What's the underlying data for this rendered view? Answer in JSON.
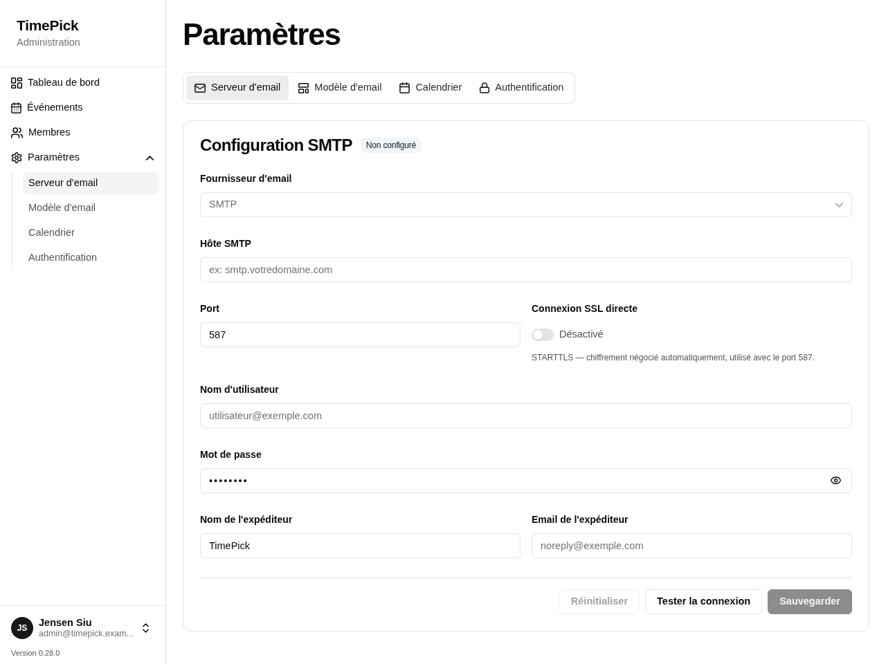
{
  "sidebar": {
    "brand": "TimePick",
    "subtitle": "Administration",
    "items": [
      {
        "label": "Tableau de bord",
        "selected": false
      },
      {
        "label": "Événements",
        "selected": false
      },
      {
        "label": "Membres",
        "selected": false
      },
      {
        "label": "Paramètres",
        "selected": false,
        "expanded": true,
        "children": [
          {
            "label": "Serveur d'email",
            "selected": true
          },
          {
            "label": "Modèle d'email",
            "selected": false
          },
          {
            "label": "Calendrier",
            "selected": false
          },
          {
            "label": "Authentification",
            "selected": false
          }
        ]
      }
    ],
    "user": {
      "initials": "JS",
      "name": "Jensen Siu",
      "email": "admin@timepick.exam..."
    },
    "version": "Version 0.28.0"
  },
  "page": {
    "title": "Paramètres",
    "tabs": [
      {
        "label": "Serveur d'email",
        "selected": true
      },
      {
        "label": "Modèle d'email",
        "selected": false
      },
      {
        "label": "Calendrier",
        "selected": false
      },
      {
        "label": "Authentification",
        "selected": false
      }
    ],
    "form": {
      "title": "Configuration SMTP",
      "status_badge": "Non configuré",
      "rows": [
        {
          "fields": [
            {
              "kind": "select",
              "label": "Fournisseur d'email",
              "value": "SMTP",
              "disabled": true
            }
          ]
        },
        {
          "fields": [
            {
              "kind": "text",
              "label": "Hôte SMTP",
              "placeholder": "ex: smtp.votredomaine.com"
            }
          ]
        },
        {
          "fields": [
            {
              "kind": "text",
              "label": "Port",
              "value": "587"
            },
            {
              "kind": "switch",
              "label": "Connexion SSL directe",
              "on": false,
              "state_text": "Désactivé",
              "help": "STARTTLS — chiffrement négocié automatiquement, utilisé avec le port 587."
            }
          ]
        },
        {
          "fields": [
            {
              "kind": "text",
              "label": "Nom d'utilisateur",
              "placeholder": "utilisateur@exemple.com"
            }
          ]
        },
        {
          "fields": [
            {
              "kind": "password",
              "label": "Mot de passe",
              "value": "••••••••"
            }
          ]
        },
        {
          "fields": [
            {
              "kind": "text",
              "label": "Nom de l'expéditeur",
              "value": "TimePick"
            },
            {
              "kind": "text",
              "label": "Email de l'expéditeur",
              "placeholder": "noreply@exemple.com"
            }
          ]
        }
      ],
      "buttons": [
        {
          "label": "Réinitialiser",
          "kind": "outline",
          "disabled": true
        },
        {
          "label": "Tester la connexion",
          "kind": "outline",
          "disabled": false
        },
        {
          "label": "Sauvegarder",
          "kind": "primary",
          "disabled": true
        }
      ]
    }
  }
}
